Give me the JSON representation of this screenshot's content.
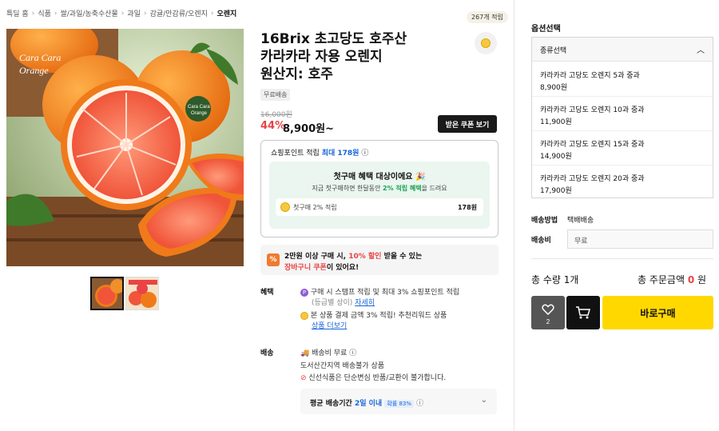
{
  "breadcrumb": [
    "특딜 홈",
    "식품",
    "쌀/과일/농축수산물",
    "과일",
    "감귤/만감류/오렌지",
    "오렌지"
  ],
  "product": {
    "title_lines": [
      "16Brix 초고당도 호주산",
      "카라카라 자용 오렌지",
      "원산지: 호주"
    ],
    "points_badge": "267개 적립",
    "free_shipping_tag": "무료배송",
    "original_price": "16,000원",
    "discount": "44%",
    "sale_price": "8,900원~",
    "coupon_button": "받은 쿠폰 보기",
    "image_label": [
      "Cara Cara",
      "Orange"
    ],
    "image_small_label": [
      "Cara Cara",
      "Orange"
    ]
  },
  "points_box": {
    "title_prefix": "쇼핑포인트 적립",
    "title_max": "최대 178원",
    "first_purchase_head": "첫구매 혜택 대상이에요 🎉",
    "first_purchase_sub_prefix": "지금 첫구매하면 한달동안",
    "first_purchase_sub_em": "2% 적립 혜택",
    "first_purchase_sub_suffix": "을 드려요",
    "first_row_label": "첫구매 2% 적립",
    "first_row_value": "178원"
  },
  "promo": {
    "icon": "%",
    "line1_prefix": "2만원 이상 구매 시,",
    "line1_em": "10% 할인",
    "line1_suffix": "받을 수 있는",
    "line2_em": "장바구니 쿠폰",
    "line2_suffix": "이 있어요!"
  },
  "benefits": {
    "label": "혜택",
    "line1": "구매 시 스탬프 적립 및 최대 3% 쇼핑포인트 적립",
    "line2_gray": "(등급별 상이)",
    "line2_link": "자세히",
    "line3": "본 상품 결제 금액 3% 적립! 추천리워드 상품",
    "line4_link": "상품 더보기"
  },
  "shipping": {
    "label": "배송",
    "line1": "배송비 무료",
    "line2": "도서산간지역 배송불가 상품",
    "line3": "신선식품은 단순변심 반품/교환이 불가합니다.",
    "avg_label": "평균 배송기간",
    "avg_value": "2일 이내",
    "avg_pct": "확률 83%"
  },
  "options": {
    "title": "옵션선택",
    "select_label": "종류선택",
    "items": [
      {
        "name": "카라카라 고당도 오렌지 5과 중과",
        "price": "8,900원"
      },
      {
        "name": "카라카라 고당도 오렌지 10과 중과",
        "price": "11,900원"
      },
      {
        "name": "카라카라 고당도 오렌지 15과 중과",
        "price": "14,900원"
      },
      {
        "name": "카라카라 고당도 오렌지 20과 중과",
        "price": "17,900원"
      }
    ]
  },
  "order": {
    "ship_method_label": "배송방법",
    "ship_method_value": "택배배송",
    "ship_fee_label": "배송비",
    "ship_fee_value": "무료",
    "total_qty_label": "총 수량",
    "total_qty_value": "1개",
    "total_amount_label": "총 주문금액",
    "total_amount_value": "0",
    "total_amount_unit": "원",
    "like_count": "2",
    "buy_button": "바로구매"
  },
  "colors": {
    "accent_red": "#e94345",
    "buy_yellow": "#ffd800",
    "link_blue": "#1664d8"
  }
}
